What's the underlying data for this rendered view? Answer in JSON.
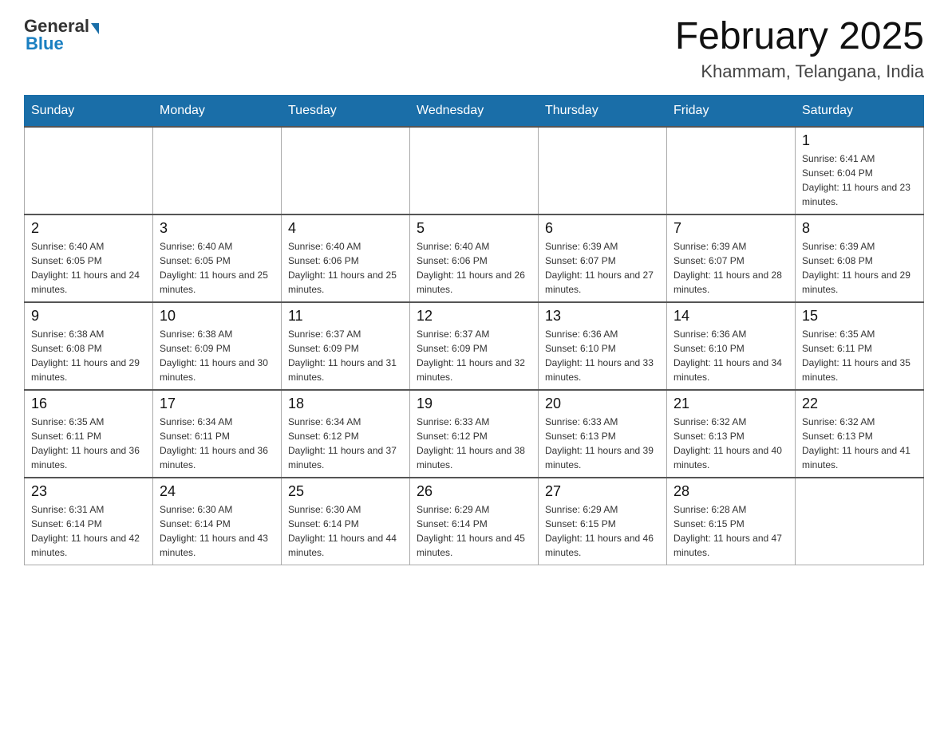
{
  "header": {
    "logo_general": "General",
    "logo_blue": "Blue",
    "title": "February 2025",
    "subtitle": "Khammam, Telangana, India"
  },
  "weekdays": [
    "Sunday",
    "Monday",
    "Tuesday",
    "Wednesday",
    "Thursday",
    "Friday",
    "Saturday"
  ],
  "weeks": [
    [
      null,
      null,
      null,
      null,
      null,
      null,
      {
        "day": 1,
        "sunrise": "6:41 AM",
        "sunset": "6:04 PM",
        "daylight": "11 hours and 23 minutes."
      }
    ],
    [
      {
        "day": 2,
        "sunrise": "6:40 AM",
        "sunset": "6:05 PM",
        "daylight": "11 hours and 24 minutes."
      },
      {
        "day": 3,
        "sunrise": "6:40 AM",
        "sunset": "6:05 PM",
        "daylight": "11 hours and 25 minutes."
      },
      {
        "day": 4,
        "sunrise": "6:40 AM",
        "sunset": "6:06 PM",
        "daylight": "11 hours and 25 minutes."
      },
      {
        "day": 5,
        "sunrise": "6:40 AM",
        "sunset": "6:06 PM",
        "daylight": "11 hours and 26 minutes."
      },
      {
        "day": 6,
        "sunrise": "6:39 AM",
        "sunset": "6:07 PM",
        "daylight": "11 hours and 27 minutes."
      },
      {
        "day": 7,
        "sunrise": "6:39 AM",
        "sunset": "6:07 PM",
        "daylight": "11 hours and 28 minutes."
      },
      {
        "day": 8,
        "sunrise": "6:39 AM",
        "sunset": "6:08 PM",
        "daylight": "11 hours and 29 minutes."
      }
    ],
    [
      {
        "day": 9,
        "sunrise": "6:38 AM",
        "sunset": "6:08 PM",
        "daylight": "11 hours and 29 minutes."
      },
      {
        "day": 10,
        "sunrise": "6:38 AM",
        "sunset": "6:09 PM",
        "daylight": "11 hours and 30 minutes."
      },
      {
        "day": 11,
        "sunrise": "6:37 AM",
        "sunset": "6:09 PM",
        "daylight": "11 hours and 31 minutes."
      },
      {
        "day": 12,
        "sunrise": "6:37 AM",
        "sunset": "6:09 PM",
        "daylight": "11 hours and 32 minutes."
      },
      {
        "day": 13,
        "sunrise": "6:36 AM",
        "sunset": "6:10 PM",
        "daylight": "11 hours and 33 minutes."
      },
      {
        "day": 14,
        "sunrise": "6:36 AM",
        "sunset": "6:10 PM",
        "daylight": "11 hours and 34 minutes."
      },
      {
        "day": 15,
        "sunrise": "6:35 AM",
        "sunset": "6:11 PM",
        "daylight": "11 hours and 35 minutes."
      }
    ],
    [
      {
        "day": 16,
        "sunrise": "6:35 AM",
        "sunset": "6:11 PM",
        "daylight": "11 hours and 36 minutes."
      },
      {
        "day": 17,
        "sunrise": "6:34 AM",
        "sunset": "6:11 PM",
        "daylight": "11 hours and 36 minutes."
      },
      {
        "day": 18,
        "sunrise": "6:34 AM",
        "sunset": "6:12 PM",
        "daylight": "11 hours and 37 minutes."
      },
      {
        "day": 19,
        "sunrise": "6:33 AM",
        "sunset": "6:12 PM",
        "daylight": "11 hours and 38 minutes."
      },
      {
        "day": 20,
        "sunrise": "6:33 AM",
        "sunset": "6:13 PM",
        "daylight": "11 hours and 39 minutes."
      },
      {
        "day": 21,
        "sunrise": "6:32 AM",
        "sunset": "6:13 PM",
        "daylight": "11 hours and 40 minutes."
      },
      {
        "day": 22,
        "sunrise": "6:32 AM",
        "sunset": "6:13 PM",
        "daylight": "11 hours and 41 minutes."
      }
    ],
    [
      {
        "day": 23,
        "sunrise": "6:31 AM",
        "sunset": "6:14 PM",
        "daylight": "11 hours and 42 minutes."
      },
      {
        "day": 24,
        "sunrise": "6:30 AM",
        "sunset": "6:14 PM",
        "daylight": "11 hours and 43 minutes."
      },
      {
        "day": 25,
        "sunrise": "6:30 AM",
        "sunset": "6:14 PM",
        "daylight": "11 hours and 44 minutes."
      },
      {
        "day": 26,
        "sunrise": "6:29 AM",
        "sunset": "6:14 PM",
        "daylight": "11 hours and 45 minutes."
      },
      {
        "day": 27,
        "sunrise": "6:29 AM",
        "sunset": "6:15 PM",
        "daylight": "11 hours and 46 minutes."
      },
      {
        "day": 28,
        "sunrise": "6:28 AM",
        "sunset": "6:15 PM",
        "daylight": "11 hours and 47 minutes."
      },
      null
    ]
  ]
}
